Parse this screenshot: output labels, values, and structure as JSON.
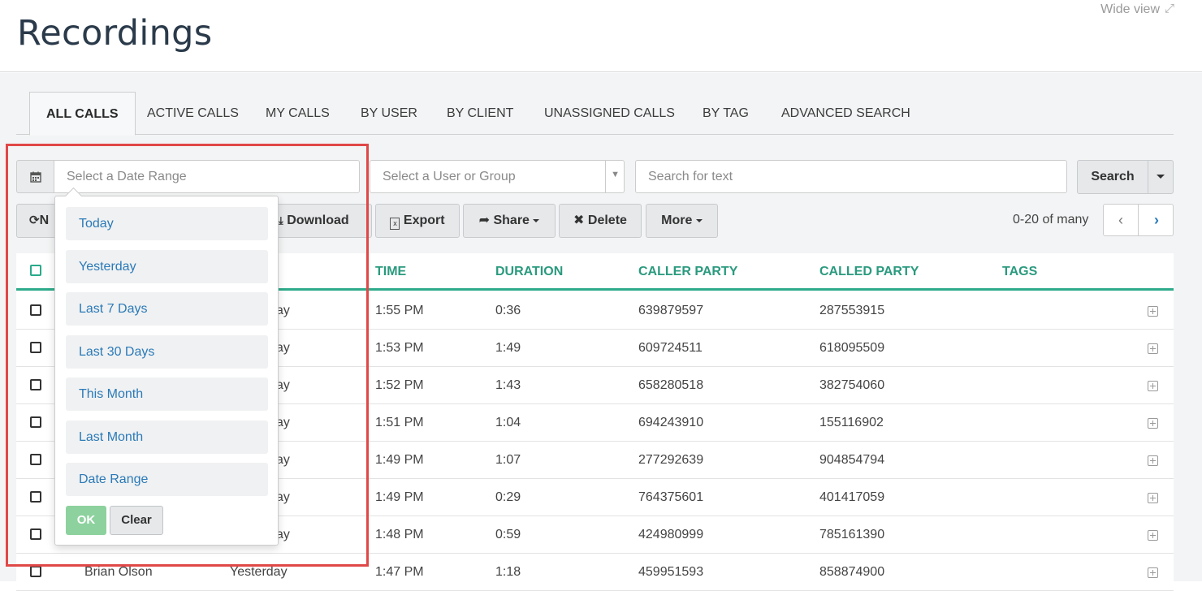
{
  "page": {
    "title": "Recordings",
    "wide_view": "Wide view",
    "wide_view_icon": "expand-arrows-icon"
  },
  "tabs": [
    {
      "label": "ALL CALLS",
      "active": true
    },
    {
      "label": "ACTIVE CALLS"
    },
    {
      "label": "MY CALLS"
    },
    {
      "label": "BY USER"
    },
    {
      "label": "BY CLIENT"
    },
    {
      "label": "UNASSIGNED CALLS"
    },
    {
      "label": "BY TAG"
    },
    {
      "label": "ADVANCED SEARCH"
    }
  ],
  "filters": {
    "date_placeholder": "Select a Date Range",
    "user_placeholder": "Select a User or Group",
    "text_placeholder": "Search for text",
    "search_label": "Search"
  },
  "toolbar": {
    "refresh_partial": "N",
    "download": "Download",
    "export": "Export",
    "share": "Share",
    "delete": "Delete",
    "more": "More",
    "pagination": "0-20 of many"
  },
  "table": {
    "headers": [
      "TIME",
      "DURATION",
      "CALLER PARTY",
      "CALLED PARTY",
      "TAGS"
    ],
    "rows": [
      {
        "partial": "ay",
        "time": "1:55 PM",
        "duration": "0:36",
        "caller": "639879597",
        "called": "287553915"
      },
      {
        "partial": "ay",
        "time": "1:53 PM",
        "duration": "1:49",
        "caller": "609724511",
        "called": "618095509"
      },
      {
        "partial": "ay",
        "time": "1:52 PM",
        "duration": "1:43",
        "caller": "658280518",
        "called": "382754060"
      },
      {
        "partial": "ay",
        "time": "1:51 PM",
        "duration": "1:04",
        "caller": "694243910",
        "called": "155116902"
      },
      {
        "partial": "ay",
        "time": "1:49 PM",
        "duration": "1:07",
        "caller": "277292639",
        "called": "904854794"
      },
      {
        "partial": "ay",
        "time": "1:49 PM",
        "duration": "0:29",
        "caller": "764375601",
        "called": "401417059"
      },
      {
        "partial": "ay",
        "time": "1:48 PM",
        "duration": "0:59",
        "caller": "424980999",
        "called": "785161390"
      },
      {
        "user": "Brian Olson",
        "date": "Yesterday",
        "time": "1:47 PM",
        "duration": "1:18",
        "caller": "459951593",
        "called": "858874900"
      }
    ]
  },
  "date_dropdown": {
    "options": [
      "Today",
      "Yesterday",
      "Last 7 Days",
      "Last 30 Days",
      "This Month",
      "Last Month",
      "Date Range"
    ],
    "ok": "OK",
    "clear": "Clear"
  },
  "colors": {
    "accent_teal": "#2eaa8a",
    "link_blue": "#2a7ab8",
    "ok_green": "#8dd29e",
    "highlight_red": "#e04848"
  }
}
